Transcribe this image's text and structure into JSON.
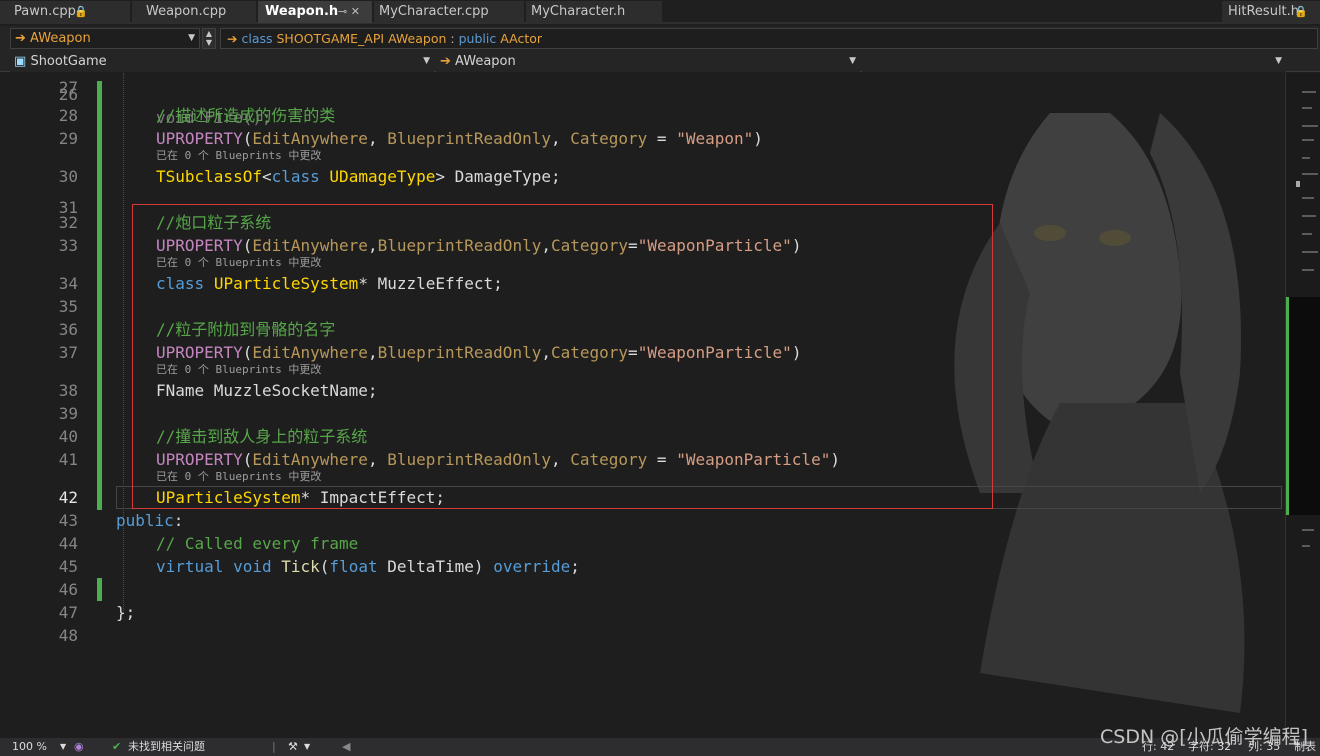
{
  "tabs": [
    {
      "label": "Pawn.cpp",
      "glyph": "🔒"
    },
    {
      "label": "Weapon.cpp",
      "glyph": ""
    },
    {
      "label": "Weapon.h",
      "glyph": "⊸ ✕"
    },
    {
      "label": "MyCharacter.cpp",
      "glyph": ""
    },
    {
      "label": "MyCharacter.h",
      "glyph": ""
    },
    {
      "label": "HitResult.h",
      "glyph": "🔒"
    }
  ],
  "nav": {
    "type_combo": "AWeapon",
    "class_prefix": "class",
    "class_api": "SHOOTGAME_API",
    "class_name": "AWeapon",
    "class_colon": ":",
    "class_access": "public",
    "class_base": "AActor",
    "project_combo": "ShootGame",
    "scope_combo": "AWeapon"
  },
  "editor": {
    "partial_line": "void Fire();",
    "lines": [
      {
        "num": "27",
        "tokens": []
      },
      {
        "num": "28",
        "tokens": [
          {
            "t": "//描述所造成的伤害的类",
            "c": "cm"
          }
        ]
      },
      {
        "num": "29",
        "tokens": [
          {
            "t": "UPROPERTY",
            "c": "mac"
          },
          {
            "t": "(",
            "c": "id"
          },
          {
            "t": "EditAnywhere",
            "c": "spec"
          },
          {
            "t": ", ",
            "c": "id"
          },
          {
            "t": "BlueprintReadOnly",
            "c": "spec"
          },
          {
            "t": ", ",
            "c": "id"
          },
          {
            "t": "Category",
            "c": "spec"
          },
          {
            "t": " = ",
            "c": "id"
          },
          {
            "t": "\"Weapon\"",
            "c": "st"
          },
          {
            "t": ")",
            "c": "id"
          }
        ]
      },
      {
        "num": "30",
        "tokens": [
          {
            "t": "TSubclassOf",
            "c": "ty"
          },
          {
            "t": "<",
            "c": "id"
          },
          {
            "t": "class",
            "c": "kw"
          },
          {
            "t": " ",
            "c": "id"
          },
          {
            "t": "UDamageType",
            "c": "ty"
          },
          {
            "t": "> DamageType;",
            "c": "id"
          }
        ]
      },
      {
        "num": "31",
        "tokens": []
      },
      {
        "num": "32",
        "tokens": [
          {
            "t": "//炮口粒子系统",
            "c": "cm"
          }
        ]
      },
      {
        "num": "33",
        "tokens": [
          {
            "t": "UPROPERTY",
            "c": "mac"
          },
          {
            "t": "(",
            "c": "id"
          },
          {
            "t": "EditAnywhere",
            "c": "spec"
          },
          {
            "t": ",",
            "c": "id"
          },
          {
            "t": "BlueprintReadOnly",
            "c": "spec"
          },
          {
            "t": ",",
            "c": "id"
          },
          {
            "t": "Category",
            "c": "spec"
          },
          {
            "t": "=",
            "c": "id"
          },
          {
            "t": "\"WeaponParticle\"",
            "c": "st"
          },
          {
            "t": ")",
            "c": "id"
          }
        ]
      },
      {
        "num": "34",
        "tokens": [
          {
            "t": "class",
            "c": "kw"
          },
          {
            "t": " ",
            "c": "id"
          },
          {
            "t": "UParticleSystem",
            "c": "ty"
          },
          {
            "t": "* MuzzleEffect;",
            "c": "id"
          }
        ]
      },
      {
        "num": "35",
        "tokens": []
      },
      {
        "num": "36",
        "tokens": [
          {
            "t": "//粒子附加到骨骼的名字",
            "c": "cm"
          }
        ]
      },
      {
        "num": "37",
        "tokens": [
          {
            "t": "UPROPERTY",
            "c": "mac"
          },
          {
            "t": "(",
            "c": "id"
          },
          {
            "t": "EditAnywhere",
            "c": "spec"
          },
          {
            "t": ",",
            "c": "id"
          },
          {
            "t": "BlueprintReadOnly",
            "c": "spec"
          },
          {
            "t": ",",
            "c": "id"
          },
          {
            "t": "Category",
            "c": "spec"
          },
          {
            "t": "=",
            "c": "id"
          },
          {
            "t": "\"WeaponParticle\"",
            "c": "st"
          },
          {
            "t": ")",
            "c": "id"
          }
        ]
      },
      {
        "num": "38",
        "tokens": [
          {
            "t": "FName MuzzleSocketName;",
            "c": "id"
          }
        ]
      },
      {
        "num": "39",
        "tokens": []
      },
      {
        "num": "40",
        "tokens": [
          {
            "t": "//撞击到敌人身上的粒子系统",
            "c": "cm"
          }
        ]
      },
      {
        "num": "41",
        "tokens": [
          {
            "t": "UPROPERTY",
            "c": "mac"
          },
          {
            "t": "(",
            "c": "id"
          },
          {
            "t": "EditAnywhere",
            "c": "spec"
          },
          {
            "t": ", ",
            "c": "id"
          },
          {
            "t": "BlueprintReadOnly",
            "c": "spec"
          },
          {
            "t": ", ",
            "c": "id"
          },
          {
            "t": "Category",
            "c": "spec"
          },
          {
            "t": " = ",
            "c": "id"
          },
          {
            "t": "\"WeaponParticle\"",
            "c": "st"
          },
          {
            "t": ")",
            "c": "id"
          }
        ]
      },
      {
        "num": "42",
        "tokens": [
          {
            "t": "UParticleSystem",
            "c": "ty"
          },
          {
            "t": "* ImpactEffect;",
            "c": "id"
          }
        ]
      },
      {
        "num": "43",
        "tokens": [
          {
            "t": "public",
            "c": "kw"
          },
          {
            "t": ":",
            "c": "id"
          }
        ]
      },
      {
        "num": "44",
        "tokens": [
          {
            "t": "// Called every frame",
            "c": "cm"
          }
        ]
      },
      {
        "num": "45",
        "tokens": [
          {
            "t": "virtual",
            "c": "kw"
          },
          {
            "t": " ",
            "c": "id"
          },
          {
            "t": "void",
            "c": "kw"
          },
          {
            "t": " ",
            "c": "id"
          },
          {
            "t": "Tick",
            "c": "fn"
          },
          {
            "t": "(",
            "c": "id"
          },
          {
            "t": "float",
            "c": "kw"
          },
          {
            "t": " DeltaTime) ",
            "c": "id"
          },
          {
            "t": "override",
            "c": "kw"
          },
          {
            "t": ";",
            "c": "id"
          }
        ]
      },
      {
        "num": "46",
        "tokens": []
      },
      {
        "num": "47",
        "tokens": [
          {
            "t": "};",
            "c": "id"
          }
        ]
      },
      {
        "num": "48",
        "tokens": []
      }
    ],
    "lens_text": "已在 0 个 Blueprints 中更改"
  },
  "status": {
    "zoom": "100 %",
    "issues": "未找到相关问题",
    "line": "行: 42",
    "char": "字符: 32",
    "col": "列: 35",
    "tabs_mode": "制表"
  },
  "watermark": "CSDN @[小瓜偷学编程]",
  "colors": {
    "accent_green": "#4cae4c",
    "selection_box": "#d43a3a",
    "keyword": "#569cd6",
    "macro": "#c586c0",
    "type": "#ffd700",
    "comment": "#57a64a",
    "string": "#d69d85"
  }
}
